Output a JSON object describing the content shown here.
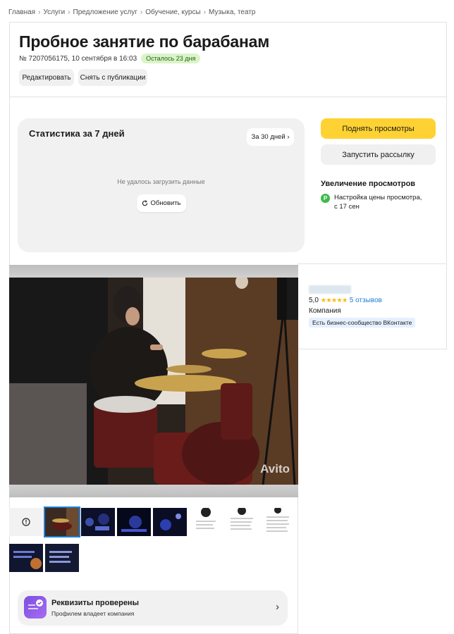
{
  "breadcrumbs": [
    "Главная",
    "Услуги",
    "Предложение услуг",
    "Обучение, курсы",
    "Музыка, театр"
  ],
  "listing": {
    "title": "Пробное занятие по барабанам",
    "meta": "№ 7207056175, 10 сентября в 16:03",
    "remaining": "Осталось 23 дня",
    "edit_label": "Редактировать",
    "unpublish_label": "Снять с публикации"
  },
  "stats": {
    "title": "Статистика за 7 дней",
    "period_button": "За 30 дней ›",
    "error": "Не удалось загрузить данные",
    "refresh_label": "Обновить"
  },
  "actions": {
    "raise_label": "Поднять просмотры",
    "mailing_label": "Запустить рассылку",
    "boost_title": "Увеличение просмотров",
    "boost_text_1": "Настройка цены просмотра,",
    "boost_text_2": "с 17 сен",
    "boost_icon": "P"
  },
  "seller": {
    "rating": "5,0",
    "stars": "★★★★★",
    "reviews": "5 отзывов",
    "type": "Компания",
    "vk_badge": "Есть бизнес-сообщество ВКонтакте"
  },
  "photo": {
    "watermark": "Avito"
  },
  "verified": {
    "title": "Реквизиты проверены",
    "subtitle": "Профилем владеет компания",
    "chevron": "›"
  },
  "colors": {
    "accent_yellow": "#ffd233",
    "badge_green": "#d9f5c8",
    "link_blue": "#1e7fd6",
    "star": "#ffb400"
  }
}
